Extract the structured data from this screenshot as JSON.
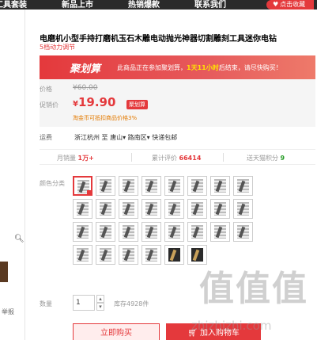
{
  "topnav": {
    "items": [
      "工具套装",
      "新品上市",
      "热销爆款",
      "联系我们"
    ],
    "favorite_label": "点击收藏",
    "favorite_icon": "heart-icon"
  },
  "sidebar": {
    "search_icon": "search-icon",
    "report_label": "举报"
  },
  "product": {
    "title": "电磨机小型手持打磨机玉石木雕电动抛光神器切割雕刻工具迷你电钻",
    "subtitle": "5档动力调节"
  },
  "promo": {
    "logo": "聚划算",
    "message_pre": "此商品正在参加聚划算，",
    "message_highlight": "1天11小时",
    "message_post": "后结束，请尽快购买！"
  },
  "price": {
    "original_label": "价格",
    "original_value": "¥60.00",
    "current_label": "促销价",
    "currency": "¥",
    "current_value": "19.90",
    "tag": "聚划算",
    "note": "淘金币可抵扣商品价格3%"
  },
  "shipping": {
    "label": "运费",
    "value": "浙江杭州 至 唐山▾ 路南区▾ 快递包邮"
  },
  "stats": {
    "sales_label": "月销量",
    "sales_value": "1万+",
    "reviews_label": "累计评价",
    "reviews_value": "66414",
    "points_label": "送天猫积分",
    "points_value": "9"
  },
  "color": {
    "label": "颜色分类",
    "swatch_count": 30,
    "selected_index": 0
  },
  "quantity": {
    "label": "数量",
    "value": "1",
    "stock": "库存4928件"
  },
  "buttons": {
    "buy_now": "立即购买",
    "add_cart": "加入购物车"
  },
  "watermark": {
    "chars": "值值值",
    "url": "zhizhizhi.com"
  },
  "colors": {
    "accent": "#e4393c",
    "nav_bg": "#2b2b2b",
    "stock_note": "#e47a00"
  }
}
